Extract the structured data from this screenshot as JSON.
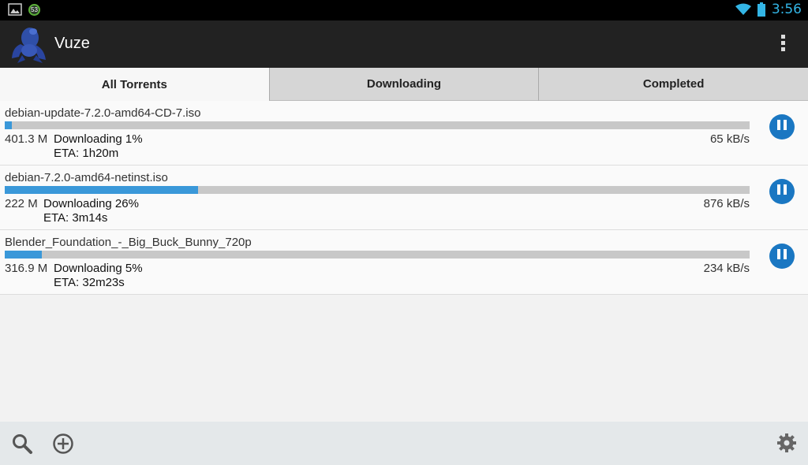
{
  "statusbar": {
    "notification_badge": "53",
    "time": "3:56",
    "icons": [
      "image-icon",
      "progress-badge-icon",
      "wifi-icon",
      "battery-icon"
    ]
  },
  "actionbar": {
    "title": "Vuze",
    "logo": "vuze-frog-logo",
    "overflow_icon": "overflow-menu-icon"
  },
  "tabs": [
    {
      "label": "All Torrents",
      "active": true
    },
    {
      "label": "Downloading",
      "active": false
    },
    {
      "label": "Completed",
      "active": false
    }
  ],
  "torrents": [
    {
      "name": "debian-update-7.2.0-amd64-CD-7.iso",
      "size": "401.3 M",
      "status": "Downloading 1%",
      "eta": "ETA: 1h20m",
      "speed": "65 kB/s",
      "progress": 0.01
    },
    {
      "name": "debian-7.2.0-amd64-netinst.iso",
      "size": "222 M",
      "status": "Downloading 26%",
      "eta": "ETA: 3m14s",
      "speed": "876 kB/s",
      "progress": 0.26
    },
    {
      "name": "Blender_Foundation_-_Big_Buck_Bunny_720p",
      "size": "316.9 M",
      "status": "Downloading 5%",
      "eta": "ETA: 32m23s",
      "speed": "234 kB/s",
      "progress": 0.05
    }
  ],
  "bottombar": {
    "icons": [
      "search-icon",
      "add-icon",
      "settings-icon"
    ]
  },
  "colors": {
    "accent": "#3a98d9",
    "pause_button": "#1a77c2",
    "clock": "#33b5e5"
  }
}
